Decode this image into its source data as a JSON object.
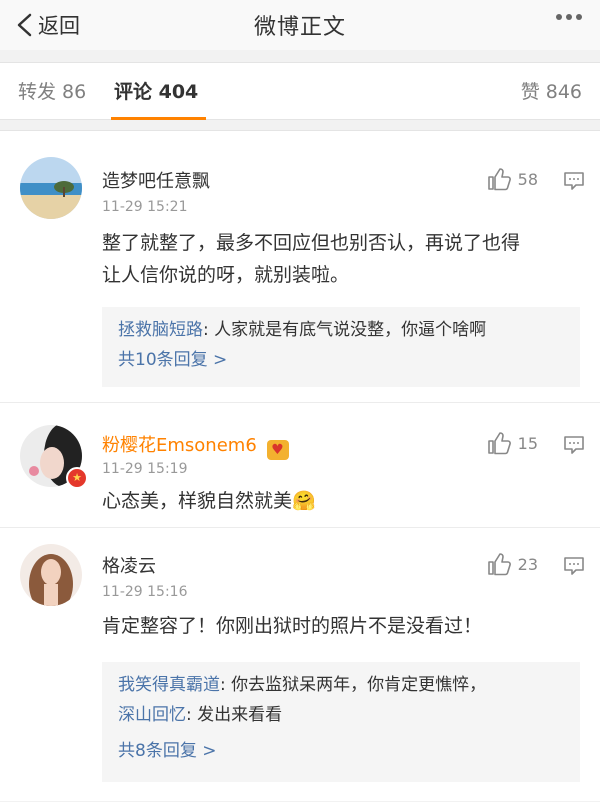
{
  "header": {
    "back_label": "返回",
    "title": "微博正文"
  },
  "tabs": {
    "repost": "转发 86",
    "comments": "评论 404",
    "likes": "赞 846"
  },
  "comments": [
    {
      "name": "造梦吧任意飘",
      "time": "11-29 15:21",
      "likes": "58",
      "text_line1": "整了就整了，最多不回应但也别否认，再说了也得",
      "text_line2": "让人信你说的呀，就别装啦。",
      "replies": [
        {
          "user": "拯救脑短路",
          "text": ": 人家就是有底气说没整，你逼个啥啊"
        }
      ],
      "more": "共10条回复 >"
    },
    {
      "name": "粉樱花Emsonem6",
      "time": "11-29 15:19",
      "likes": "15",
      "text": "心态美，样貌自然就美",
      "emoji": "🤗"
    },
    {
      "name": "格凌云",
      "time": "11-29 15:16",
      "likes": "23",
      "text": "肯定整容了！你刚出狱时的照片不是没看过！",
      "replies": [
        {
          "user": "我笑得真霸道",
          "text": ": 你去监狱呆两年，你肯定更憔悴，"
        },
        {
          "user": "深山回忆",
          "text": ": 发出来看看"
        }
      ],
      "more": "共8条回复 >"
    }
  ]
}
